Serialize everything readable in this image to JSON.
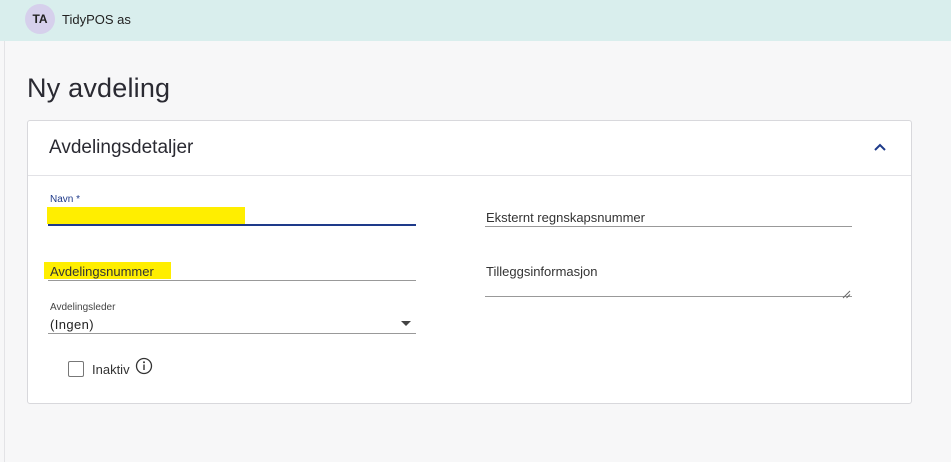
{
  "header": {
    "avatar_initials": "TA",
    "company_name": "TidyPOS as"
  },
  "page": {
    "title": "Ny avdeling"
  },
  "card": {
    "title": "Avdelingsdetaljer",
    "collapse_icon": "chevron-up-icon"
  },
  "form": {
    "name": {
      "label": "Navn *",
      "value": ""
    },
    "department_number": {
      "placeholder": "Avdelingsnummer",
      "value": ""
    },
    "department_manager": {
      "label": "Avdelingsleder",
      "value": "(Ingen)"
    },
    "inactive": {
      "label": "Inaktiv",
      "checked": false,
      "info_icon": "info-circle-icon"
    },
    "external_accounting_number": {
      "placeholder": "Eksternt regnskapsnummer",
      "value": ""
    },
    "additional_info": {
      "placeholder": "Tilleggsinformasjon",
      "value": ""
    }
  },
  "colors": {
    "topbar": "#d9eeed",
    "avatar": "#d6d0ec",
    "focus": "#1e3a8a",
    "highlight": "#ffee00"
  }
}
